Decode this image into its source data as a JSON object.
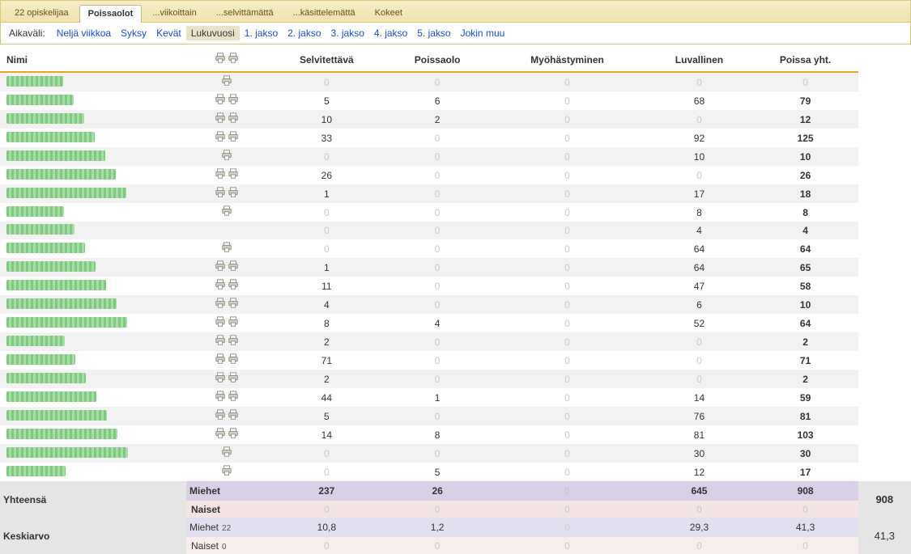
{
  "tabs": [
    {
      "label": "22 opiskelijaa",
      "active": false
    },
    {
      "label": "Poissaolot",
      "active": true
    },
    {
      "label": "...viikoittain",
      "active": false
    },
    {
      "label": "...selvittämättä",
      "active": false
    },
    {
      "label": "...käsittelemättä",
      "active": false
    },
    {
      "label": "Kokeet",
      "active": false
    }
  ],
  "filters": {
    "label": "Aikaväli:",
    "items": [
      {
        "label": "Neljä viikkoa",
        "active": false
      },
      {
        "label": "Syksy",
        "active": false
      },
      {
        "label": "Kevät",
        "active": false
      },
      {
        "label": "Lukuvuosi",
        "active": true
      },
      {
        "label": "1. jakso",
        "active": false
      },
      {
        "label": "2. jakso",
        "active": false
      },
      {
        "label": "3. jakso",
        "active": false
      },
      {
        "label": "4. jakso",
        "active": false
      },
      {
        "label": "5. jakso",
        "active": false
      },
      {
        "label": "Jokin muu",
        "active": false
      }
    ]
  },
  "columns": {
    "name": "Nimi",
    "c1": "Selvitettävä",
    "c2": "Poissaolo",
    "c3": "Myöhästyminen",
    "c4": "Luvallinen",
    "c5": "Poissa yht."
  },
  "rows": [
    {
      "printers": 1,
      "selv": 0,
      "pois": 0,
      "myoh": 0,
      "luv": 0,
      "tot": 0
    },
    {
      "printers": 2,
      "selv": 5,
      "pois": 6,
      "myoh": 0,
      "luv": 68,
      "tot": 79
    },
    {
      "printers": 2,
      "selv": 10,
      "pois": 2,
      "myoh": 0,
      "luv": 0,
      "tot": 12
    },
    {
      "printers": 2,
      "selv": 33,
      "pois": 0,
      "myoh": 0,
      "luv": 92,
      "tot": 125
    },
    {
      "printers": 1,
      "selv": 0,
      "pois": 0,
      "myoh": 0,
      "luv": 10,
      "tot": 10
    },
    {
      "printers": 2,
      "selv": 26,
      "pois": 0,
      "myoh": 0,
      "luv": 0,
      "tot": 26
    },
    {
      "printers": 2,
      "selv": 1,
      "pois": 0,
      "myoh": 0,
      "luv": 17,
      "tot": 18
    },
    {
      "printers": 1,
      "selv": 0,
      "pois": 0,
      "myoh": 0,
      "luv": 8,
      "tot": 8
    },
    {
      "printers": 0,
      "selv": 0,
      "pois": 0,
      "myoh": 0,
      "luv": 4,
      "tot": 4
    },
    {
      "printers": 1,
      "selv": 0,
      "pois": 0,
      "myoh": 0,
      "luv": 64,
      "tot": 64
    },
    {
      "printers": 2,
      "selv": 1,
      "pois": 0,
      "myoh": 0,
      "luv": 64,
      "tot": 65
    },
    {
      "printers": 2,
      "selv": 11,
      "pois": 0,
      "myoh": 0,
      "luv": 47,
      "tot": 58
    },
    {
      "printers": 2,
      "selv": 4,
      "pois": 0,
      "myoh": 0,
      "luv": 6,
      "tot": 10
    },
    {
      "printers": 2,
      "selv": 8,
      "pois": 4,
      "myoh": 0,
      "luv": 52,
      "tot": 64
    },
    {
      "printers": 2,
      "selv": 2,
      "pois": 0,
      "myoh": 0,
      "luv": 0,
      "tot": 2
    },
    {
      "printers": 2,
      "selv": 71,
      "pois": 0,
      "myoh": 0,
      "luv": 0,
      "tot": 71
    },
    {
      "printers": 2,
      "selv": 2,
      "pois": 0,
      "myoh": 0,
      "luv": 0,
      "tot": 2
    },
    {
      "printers": 2,
      "selv": 44,
      "pois": 1,
      "myoh": 0,
      "luv": 14,
      "tot": 59
    },
    {
      "printers": 2,
      "selv": 5,
      "pois": 0,
      "myoh": 0,
      "luv": 76,
      "tot": 81
    },
    {
      "printers": 2,
      "selv": 14,
      "pois": 8,
      "myoh": 0,
      "luv": 81,
      "tot": 103
    },
    {
      "printers": 1,
      "selv": 0,
      "pois": 0,
      "myoh": 0,
      "luv": 30,
      "tot": 30
    },
    {
      "printers": 1,
      "selv": 0,
      "pois": 5,
      "myoh": 0,
      "luv": 12,
      "tot": 17
    }
  ],
  "summary": {
    "total_label": "Yhteensä",
    "avg_label": "Keskiarvo",
    "men_label": "Miehet",
    "women_label": "Naiset",
    "men_count": "22",
    "women_count": "0",
    "men_totals": {
      "selv": "237",
      "pois": "26",
      "myoh": 0,
      "luv": "645",
      "sub": "908"
    },
    "women_totals": {
      "selv": 0,
      "pois": 0,
      "myoh": 0,
      "luv": 0,
      "sub": 0
    },
    "grand_total": "908",
    "men_avg": {
      "selv": "10,8",
      "pois": "1,2",
      "myoh": 0,
      "luv": "29,3",
      "sub": "41,3"
    },
    "women_avg": {
      "selv": 0,
      "pois": 0,
      "myoh": 0,
      "luv": 0,
      "sub": 0
    },
    "grand_avg": "41,3"
  }
}
